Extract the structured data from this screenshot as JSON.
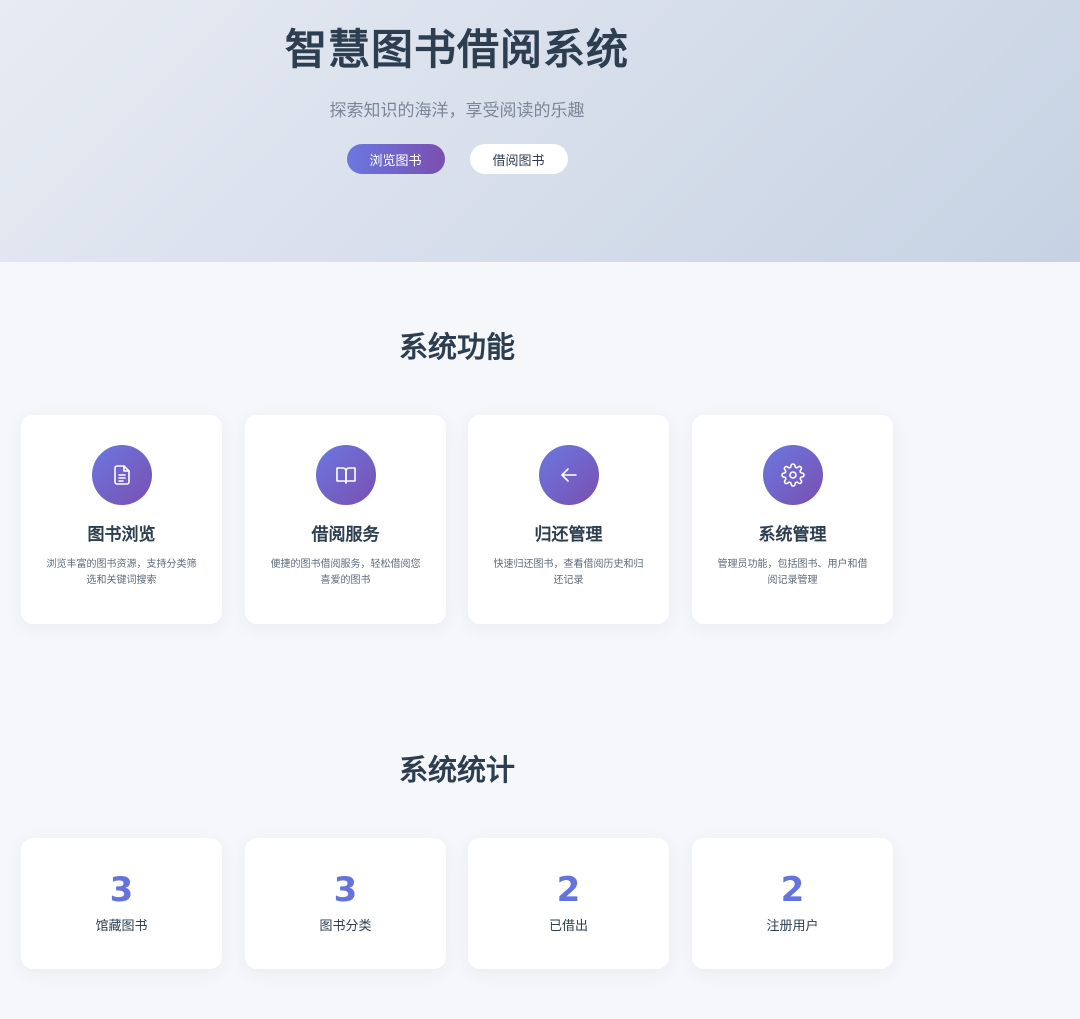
{
  "hero": {
    "title": "智慧图书借阅系统",
    "subtitle": "探索知识的海洋，享受阅读的乐趣",
    "browse_button": "浏览图书",
    "borrow_button": "借阅图书"
  },
  "features": {
    "section_title": "系统功能",
    "items": [
      {
        "icon": "document-icon",
        "title": "图书浏览",
        "desc": "浏览丰富的图书资源，支持分类筛选和关键词搜索"
      },
      {
        "icon": "open-book-icon",
        "title": "借阅服务",
        "desc": "便捷的图书借阅服务，轻松借阅您喜爱的图书"
      },
      {
        "icon": "arrow-left-icon",
        "title": "归还管理",
        "desc": "快速归还图书，查看借阅历史和归还记录"
      },
      {
        "icon": "gear-icon",
        "title": "系统管理",
        "desc": "管理员功能，包括图书、用户和借阅记录管理"
      }
    ]
  },
  "stats": {
    "section_title": "系统统计",
    "items": [
      {
        "value": "3",
        "label": "馆藏图书"
      },
      {
        "value": "3",
        "label": "图书分类"
      },
      {
        "value": "2",
        "label": "已借出"
      },
      {
        "value": "2",
        "label": "注册用户"
      }
    ]
  },
  "colors": {
    "accent_start": "#6a78e0",
    "accent_end": "#7a4fb0",
    "stat_value": "#6474dc",
    "heading": "#2c3e50"
  }
}
